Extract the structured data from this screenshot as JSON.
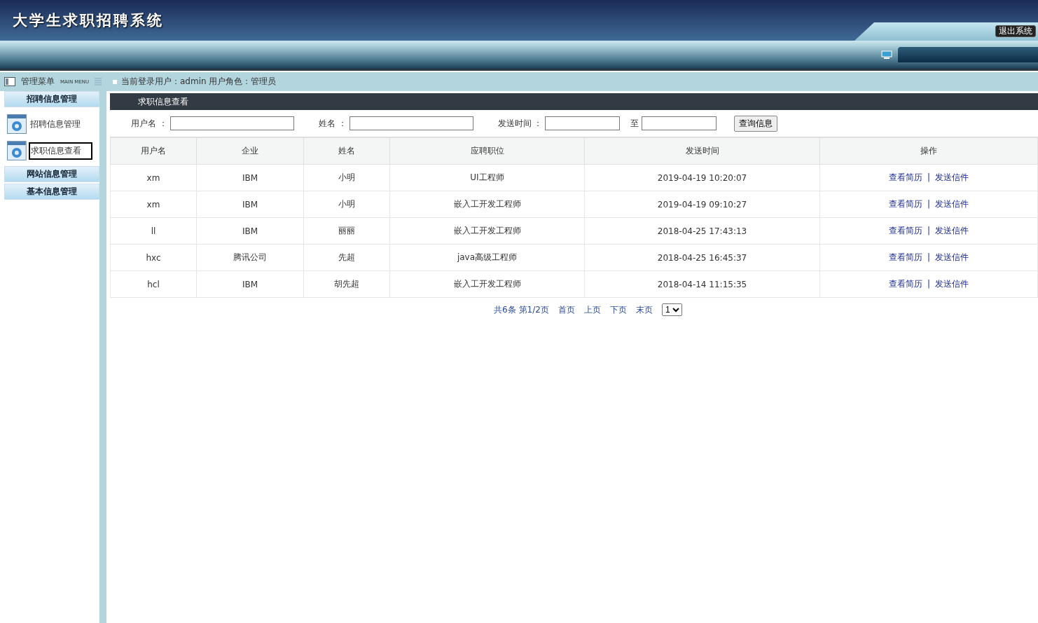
{
  "header": {
    "title": "大学生求职招聘系统",
    "logout": "退出系统"
  },
  "infobar": {
    "menu_title": "管理菜单",
    "menu_subtitle": "MAIN MENU",
    "user_text": "当前登录用户：admin  用户角色：管理员"
  },
  "sidebar": {
    "groups": [
      {
        "label": "招聘信息管理",
        "items": [
          {
            "label": "招聘信息管理",
            "selected": false
          },
          {
            "label": "求职信息查看",
            "selected": true
          }
        ]
      },
      {
        "label": "网站信息管理"
      },
      {
        "label": "基本信息管理"
      }
    ]
  },
  "panel": {
    "title": "求职信息查看"
  },
  "search": {
    "fields": [
      {
        "label": "用户名 ：",
        "kind": "wide"
      },
      {
        "label": "姓名 ：",
        "kind": "wide"
      },
      {
        "label": "发送时间 ：",
        "kind": "narrow"
      },
      {
        "label": "至",
        "kind": "narrow"
      }
    ],
    "button": "查询信息"
  },
  "table": {
    "columns": [
      "用户名",
      "企业",
      "姓名",
      "应聘职位",
      "发送时间",
      "操作"
    ],
    "rows": [
      {
        "cells": [
          "xm",
          "IBM",
          "小明",
          "UI工程师",
          "2019-04-19 10:20:07"
        ],
        "actions": [
          "查看简历",
          "发送信件"
        ]
      },
      {
        "cells": [
          "xm",
          "IBM",
          "小明",
          "嵌入工开发工程师",
          "2019-04-19 09:10:27"
        ],
        "actions": [
          "查看简历",
          "发送信件"
        ]
      },
      {
        "cells": [
          "ll",
          "IBM",
          "丽丽",
          "嵌入工开发工程师",
          "2018-04-25 17:43:13"
        ],
        "actions": [
          "查看简历",
          "发送信件"
        ]
      },
      {
        "cells": [
          "hxc",
          "腾讯公司",
          "先超",
          "java高级工程师",
          "2018-04-25 16:45:37"
        ],
        "actions": [
          "查看简历",
          "发送信件"
        ]
      },
      {
        "cells": [
          "hcl",
          "IBM",
          "胡先超",
          "嵌入工开发工程师",
          "2018-04-14 11:15:35"
        ],
        "actions": [
          "查看简历",
          "发送信件"
        ]
      }
    ],
    "action_separator": "|"
  },
  "pagination": {
    "summary": "共6条 第1/2页",
    "links": [
      "首页",
      "上页",
      "下页",
      "末页"
    ],
    "page_select": "1"
  }
}
